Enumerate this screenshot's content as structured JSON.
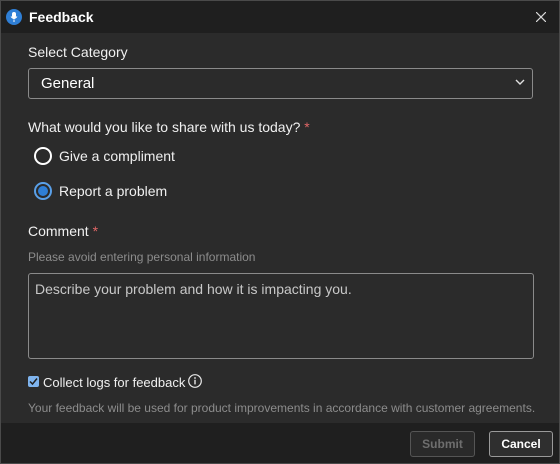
{
  "window": {
    "title": "Feedback",
    "app_icon": "feedback-icon",
    "close_icon": "close-icon"
  },
  "category": {
    "label": "Select Category",
    "selected": "General"
  },
  "share": {
    "question": "What would you like to share with us today?",
    "required_mark": "*",
    "options": [
      {
        "label": "Give a compliment",
        "checked": false
      },
      {
        "label": "Report a problem",
        "checked": true
      }
    ]
  },
  "comment": {
    "label": "Comment",
    "required_mark": "*",
    "hint": "Please avoid entering personal information",
    "placeholder": "Describe your problem and how it is impacting you.",
    "value": ""
  },
  "logs": {
    "label": "Collect logs for feedback",
    "checked": true,
    "info_icon": "info-icon"
  },
  "disclaimer": "Your feedback will be used for product improvements in accordance with customer agreements.",
  "footer": {
    "submit_label": "Submit",
    "cancel_label": "Cancel"
  },
  "colors": {
    "accent": "#2f7fd6",
    "required": "#e06666",
    "titlebar": "#1f1f1f",
    "body": "#2b2b2b"
  }
}
